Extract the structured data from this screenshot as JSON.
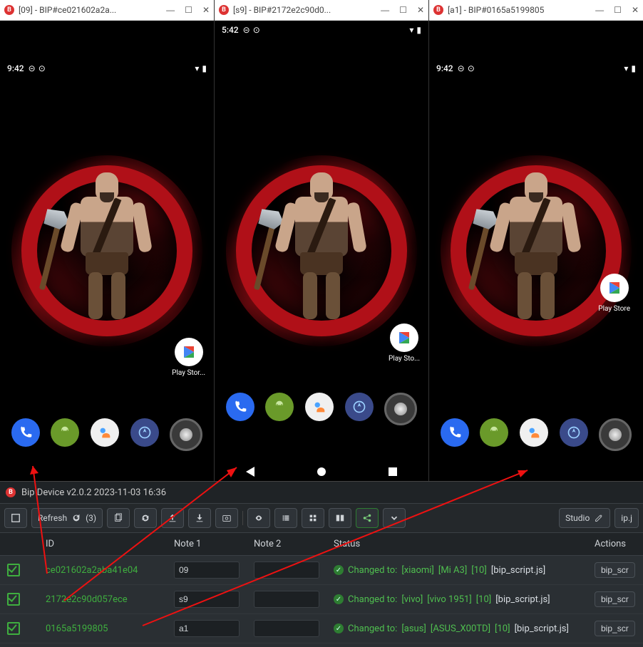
{
  "windows": [
    {
      "title": "[09] - BIP#ce021602a2a...",
      "time": "9:42",
      "store_label": "Play Stor...",
      "store_pos": "lower",
      "dock_bottom": false,
      "show_nav": false,
      "statusbar_big": true
    },
    {
      "title": "[s9] - BIP#2172e2c90d0...",
      "time": "5:42",
      "store_label": "Play Sto...",
      "store_pos": "mid",
      "dock_bottom": false,
      "show_nav": true,
      "statusbar_big": false
    },
    {
      "title": "[a1] - BIP#0165a5199805",
      "time": "9:42",
      "store_label": "Play Store",
      "store_pos": "upper",
      "dock_bottom": false,
      "show_nav": false,
      "statusbar_big": true
    }
  ],
  "panel_title": "Bip Device v2.0.2 2023-11-03 16:36",
  "toolbar": {
    "refresh": "Refresh",
    "refresh_count": "(3)",
    "studio": "Studio",
    "ipj": "ip.j"
  },
  "columns": {
    "id": "ID",
    "note1": "Note 1",
    "note2": "Note 2",
    "status": "Status",
    "actions": "Actions"
  },
  "rows": [
    {
      "id": "ce021602a2aba41e04",
      "note1": "09",
      "note2": "",
      "status": {
        "prefix": "Changed to:",
        "parts": [
          "[xiaomi]",
          "[Mi A3]",
          "[10]"
        ],
        "suffix": "[bip_script.js]"
      },
      "action": "bip_scr"
    },
    {
      "id": "2172e2c90d057ece",
      "note1": "s9",
      "note2": "",
      "status": {
        "prefix": "Changed to:",
        "parts": [
          "[vivo]",
          "[vivo 1951]",
          "[10]"
        ],
        "suffix": "[bip_script.js]"
      },
      "action": "bip_scr"
    },
    {
      "id": "0165a5199805",
      "note1": "a1",
      "note2": "",
      "status": {
        "prefix": "Changed to:",
        "parts": [
          "[asus]",
          "[ASUS_X00TD]",
          "[10]"
        ],
        "suffix": "[bip_script.js]"
      },
      "action": "bip_scr"
    }
  ],
  "dock_apps": [
    "phone",
    "android",
    "contacts",
    "navigate",
    "camera"
  ]
}
